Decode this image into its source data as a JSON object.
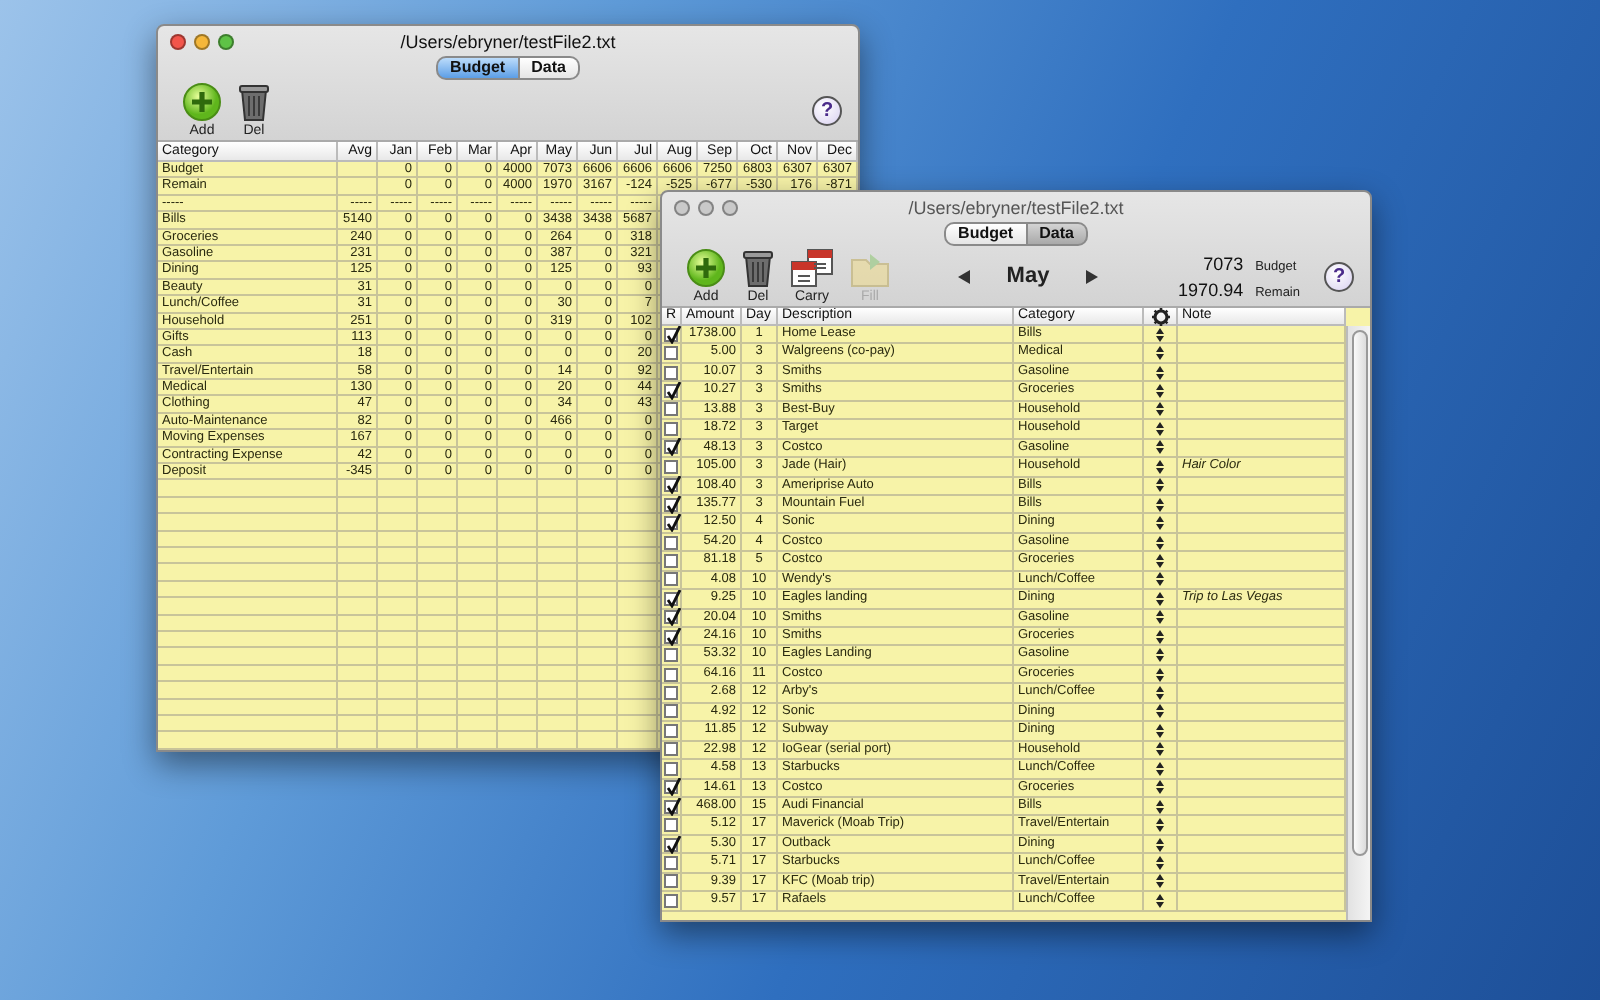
{
  "back_window": {
    "title": "/Users/ebryner/testFile2.txt",
    "active": true,
    "tabs": [
      {
        "label": "Budget",
        "selected": true
      },
      {
        "label": "Data",
        "selected": false
      }
    ],
    "toolbar": [
      {
        "label": "Add",
        "kind": "add"
      },
      {
        "label": "Del",
        "kind": "delete"
      }
    ],
    "help": "?",
    "table": {
      "columns": [
        "Category",
        "Avg",
        "Jan",
        "Feb",
        "Mar",
        "Apr",
        "May",
        "Jun",
        "Jul",
        "Aug",
        "Sep",
        "Oct",
        "Nov",
        "Dec"
      ],
      "rows": [
        {
          "category": "Budget",
          "months": [
            "0",
            "0",
            "0",
            "4000",
            "7073",
            "6606",
            "6606",
            "6606",
            "7250",
            "6803",
            "6307",
            "6307"
          ]
        },
        {
          "category": "Remain",
          "months": [
            "0",
            "0",
            "0",
            "4000",
            "1970",
            "3167",
            "-124",
            "-525",
            "-677",
            "-530",
            "176",
            "-871"
          ]
        },
        {
          "category": "-----",
          "avg": "-----",
          "months": [
            "-----",
            "-----",
            "-----",
            "-----",
            "-----",
            "-----",
            "-----"
          ]
        },
        {
          "category": "Bills",
          "avg": "5140",
          "months": [
            "0",
            "0",
            "0",
            "0",
            "3438",
            "3438",
            "5687"
          ]
        },
        {
          "category": "Groceries",
          "avg": "240",
          "months": [
            "0",
            "0",
            "0",
            "0",
            "264",
            "0",
            "318"
          ]
        },
        {
          "category": "Gasoline",
          "avg": "231",
          "months": [
            "0",
            "0",
            "0",
            "0",
            "387",
            "0",
            "321"
          ]
        },
        {
          "category": "Dining",
          "avg": "125",
          "months": [
            "0",
            "0",
            "0",
            "0",
            "125",
            "0",
            "93"
          ]
        },
        {
          "category": "Beauty",
          "avg": "31",
          "months": [
            "0",
            "0",
            "0",
            "0",
            "0",
            "0",
            "0"
          ]
        },
        {
          "category": "Lunch/Coffee",
          "avg": "31",
          "months": [
            "0",
            "0",
            "0",
            "0",
            "30",
            "0",
            "7"
          ]
        },
        {
          "category": "Household",
          "avg": "251",
          "months": [
            "0",
            "0",
            "0",
            "0",
            "319",
            "0",
            "102"
          ]
        },
        {
          "category": "Gifts",
          "avg": "113",
          "months": [
            "0",
            "0",
            "0",
            "0",
            "0",
            "0",
            "0"
          ]
        },
        {
          "category": "Cash",
          "avg": "18",
          "months": [
            "0",
            "0",
            "0",
            "0",
            "0",
            "0",
            "20"
          ]
        },
        {
          "category": "Travel/Entertain",
          "avg": "58",
          "months": [
            "0",
            "0",
            "0",
            "0",
            "14",
            "0",
            "92"
          ]
        },
        {
          "category": "Medical",
          "avg": "130",
          "months": [
            "0",
            "0",
            "0",
            "0",
            "20",
            "0",
            "44"
          ]
        },
        {
          "category": "Clothing",
          "avg": "47",
          "months": [
            "0",
            "0",
            "0",
            "0",
            "34",
            "0",
            "43"
          ]
        },
        {
          "category": "Auto-Maintenance",
          "avg": "82",
          "months": [
            "0",
            "0",
            "0",
            "0",
            "466",
            "0",
            "0"
          ]
        },
        {
          "category": "Moving Expenses",
          "avg": "167",
          "months": [
            "0",
            "0",
            "0",
            "0",
            "0",
            "0",
            "0"
          ]
        },
        {
          "category": "Contracting Expense",
          "avg": "42",
          "months": [
            "0",
            "0",
            "0",
            "0",
            "0",
            "0",
            "0"
          ]
        },
        {
          "category": "Deposit",
          "avg": "-345",
          "months": [
            "0",
            "0",
            "0",
            "0",
            "0",
            "0",
            "0"
          ]
        }
      ]
    }
  },
  "front_window": {
    "title": "/Users/ebryner/testFile2.txt",
    "active": false,
    "tabs": [
      {
        "label": "Budget",
        "selected": false
      },
      {
        "label": "Data",
        "selected": true
      }
    ],
    "toolbar": [
      {
        "label": "Add",
        "kind": "add",
        "disabled": false
      },
      {
        "label": "Del",
        "kind": "delete",
        "disabled": false
      },
      {
        "label": "Carry",
        "kind": "carry",
        "disabled": false
      },
      {
        "label": "Fill",
        "kind": "fill",
        "disabled": true
      }
    ],
    "month": "May",
    "totals": [
      {
        "value": "7073",
        "label": "Budget"
      },
      {
        "value": "1970.94",
        "label": "Remain"
      }
    ],
    "help": "?",
    "table": {
      "columns": [
        "R",
        "Amount",
        "Day",
        "Description",
        "Category",
        "Note"
      ],
      "rows": [
        {
          "checked": true,
          "amount": "1738.00",
          "day": "1",
          "description": "Home Lease",
          "category": "Bills"
        },
        {
          "checked": false,
          "amount": "5.00",
          "day": "3",
          "description": "Walgreens (co-pay)",
          "category": "Medical"
        },
        {
          "checked": false,
          "amount": "10.07",
          "day": "3",
          "description": "Smiths",
          "category": "Gasoline"
        },
        {
          "checked": true,
          "amount": "10.27",
          "day": "3",
          "description": "Smiths",
          "category": "Groceries"
        },
        {
          "checked": false,
          "amount": "13.88",
          "day": "3",
          "description": "Best-Buy",
          "category": "Household"
        },
        {
          "checked": false,
          "amount": "18.72",
          "day": "3",
          "description": "Target",
          "category": "Household"
        },
        {
          "checked": true,
          "amount": "48.13",
          "day": "3",
          "description": "Costco",
          "category": "Gasoline"
        },
        {
          "checked": false,
          "amount": "105.00",
          "day": "3",
          "description": "Jade (Hair)",
          "category": "Household",
          "note": "Hair Color"
        },
        {
          "checked": true,
          "amount": "108.40",
          "day": "3",
          "description": "Ameriprise Auto",
          "category": "Bills"
        },
        {
          "checked": true,
          "amount": "135.77",
          "day": "3",
          "description": "Mountain Fuel",
          "category": "Bills"
        },
        {
          "checked": true,
          "amount": "12.50",
          "day": "4",
          "description": "Sonic",
          "category": "Dining"
        },
        {
          "checked": false,
          "amount": "54.20",
          "day": "4",
          "description": "Costco",
          "category": "Gasoline"
        },
        {
          "checked": false,
          "amount": "81.18",
          "day": "5",
          "description": "Costco",
          "category": "Groceries"
        },
        {
          "checked": false,
          "amount": "4.08",
          "day": "10",
          "description": "Wendy's",
          "category": "Lunch/Coffee"
        },
        {
          "checked": true,
          "amount": "9.25",
          "day": "10",
          "description": "Eagles landing",
          "category": "Dining",
          "note": "Trip to Las Vegas"
        },
        {
          "checked": true,
          "amount": "20.04",
          "day": "10",
          "description": "Smiths",
          "category": "Gasoline"
        },
        {
          "checked": true,
          "amount": "24.16",
          "day": "10",
          "description": "Smiths",
          "category": "Groceries"
        },
        {
          "checked": false,
          "amount": "53.32",
          "day": "10",
          "description": "Eagles Landing",
          "category": "Gasoline"
        },
        {
          "checked": false,
          "amount": "64.16",
          "day": "11",
          "description": "Costco",
          "category": "Groceries"
        },
        {
          "checked": false,
          "amount": "2.68",
          "day": "12",
          "description": "Arby's",
          "category": "Lunch/Coffee"
        },
        {
          "checked": false,
          "amount": "4.92",
          "day": "12",
          "description": "Sonic",
          "category": "Dining"
        },
        {
          "checked": false,
          "amount": "11.85",
          "day": "12",
          "description": "Subway",
          "category": "Dining"
        },
        {
          "checked": false,
          "amount": "22.98",
          "day": "12",
          "description": "IoGear (serial port)",
          "category": "Household"
        },
        {
          "checked": false,
          "amount": "4.58",
          "day": "13",
          "description": "Starbucks",
          "category": "Lunch/Coffee"
        },
        {
          "checked": true,
          "amount": "14.61",
          "day": "13",
          "description": "Costco",
          "category": "Groceries"
        },
        {
          "checked": true,
          "amount": "468.00",
          "day": "15",
          "description": "Audi Financial",
          "category": "Bills"
        },
        {
          "checked": false,
          "amount": "5.12",
          "day": "17",
          "description": "Maverick (Moab Trip)",
          "category": "Travel/Entertain"
        },
        {
          "checked": true,
          "amount": "5.30",
          "day": "17",
          "description": "Outback",
          "category": "Dining"
        },
        {
          "checked": false,
          "amount": "5.71",
          "day": "17",
          "description": "Starbucks",
          "category": "Lunch/Coffee"
        },
        {
          "checked": false,
          "amount": "9.39",
          "day": "17",
          "description": "KFC (Moab trip)",
          "category": "Travel/Entertain"
        },
        {
          "checked": false,
          "amount": "9.57",
          "day": "17",
          "description": "Rafaels",
          "category": "Lunch/Coffee"
        }
      ]
    }
  }
}
